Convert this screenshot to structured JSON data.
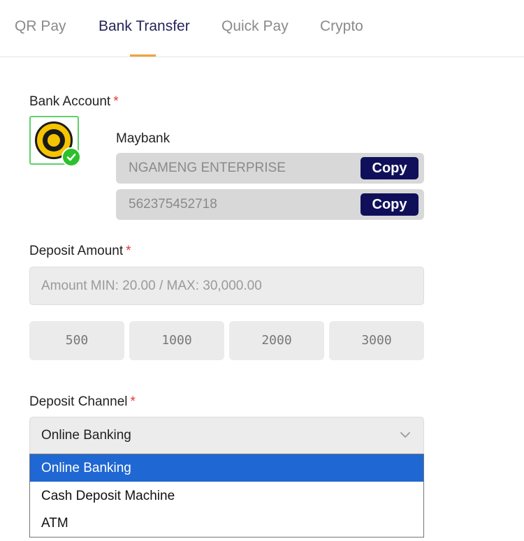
{
  "tabs": [
    {
      "label": "QR Pay",
      "active": false
    },
    {
      "label": "Bank Transfer",
      "active": true
    },
    {
      "label": "Quick Pay",
      "active": false
    },
    {
      "label": "Crypto",
      "active": false
    }
  ],
  "bank_account": {
    "label": "Bank Account",
    "required_mark": "*",
    "bank_name": "Maybank",
    "logo_icon": "maybank-tiger-logo",
    "selected_icon": "check-circle-icon",
    "account_name": "NGAMENG ENTERPRISE",
    "account_number": "562375452718",
    "copy_label": "Copy"
  },
  "deposit_amount": {
    "label": "Deposit Amount",
    "required_mark": "*",
    "placeholder": "Amount MIN: 20.00 / MAX: 30,000.00",
    "quick_amounts": [
      "500",
      "1000",
      "2000",
      "3000"
    ]
  },
  "deposit_channel": {
    "label": "Deposit Channel",
    "required_mark": "*",
    "selected": "Online Banking",
    "options": [
      "Online Banking",
      "Cash Deposit Machine",
      "ATM"
    ],
    "highlighted_index": 0
  },
  "colors": {
    "accent": "#f2a23c",
    "active_tab": "#24245a",
    "copy_button": "#10105a",
    "highlight": "#1f67d2",
    "required": "#e53935",
    "selected_border": "#5fd16a"
  }
}
